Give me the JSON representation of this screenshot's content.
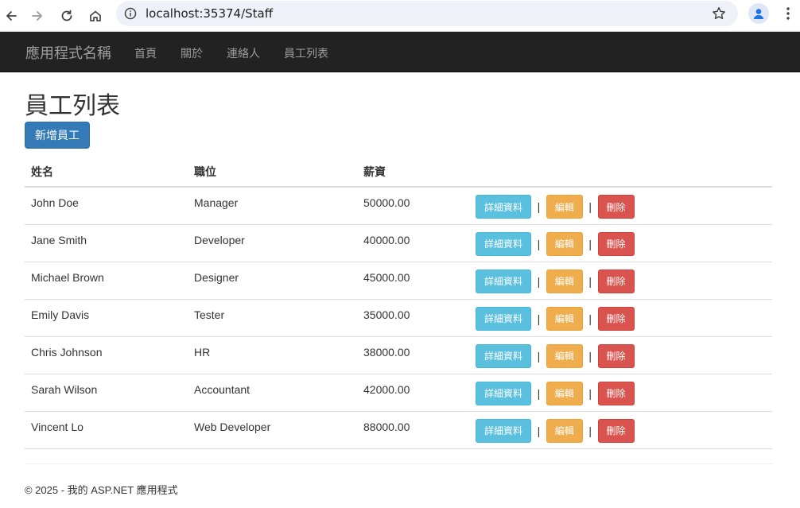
{
  "browser": {
    "url": "localhost:35374/Staff",
    "icons": [
      "back-arrow-icon",
      "forward-arrow-icon",
      "reload-icon",
      "home-icon",
      "info-icon",
      "star-icon",
      "profile-icon",
      "menu-dots-icon"
    ]
  },
  "navbar": {
    "brand": "應用程式名稱",
    "links": [
      "首頁",
      "關於",
      "連絡人",
      "員工列表"
    ]
  },
  "page": {
    "title": "員工列表",
    "new_button": "新增員工"
  },
  "table": {
    "headers": [
      "姓名",
      "職位",
      "薪資",
      ""
    ],
    "rows": [
      {
        "name": "John Doe",
        "position": "Manager",
        "salary": "50000.00"
      },
      {
        "name": "Jane Smith",
        "position": "Developer",
        "salary": "40000.00"
      },
      {
        "name": "Michael Brown",
        "position": "Designer",
        "salary": "45000.00"
      },
      {
        "name": "Emily Davis",
        "position": "Tester",
        "salary": "35000.00"
      },
      {
        "name": "Chris Johnson",
        "position": "HR",
        "salary": "38000.00"
      },
      {
        "name": "Sarah Wilson",
        "position": "Accountant",
        "salary": "42000.00"
      },
      {
        "name": "Vincent Lo",
        "position": "Web Developer",
        "salary": "88000.00"
      }
    ],
    "actions": {
      "details": "詳細資料",
      "edit": "編輯",
      "delete": "刪除",
      "separator": "|"
    }
  },
  "footer": {
    "text": "© 2025 - 我的 ASP.NET 應用程式"
  },
  "colors": {
    "navbar_bg": "#222222",
    "primary": "#337ab7",
    "info": "#5bc0de",
    "warning": "#f0ad4e",
    "danger": "#d9534f"
  }
}
